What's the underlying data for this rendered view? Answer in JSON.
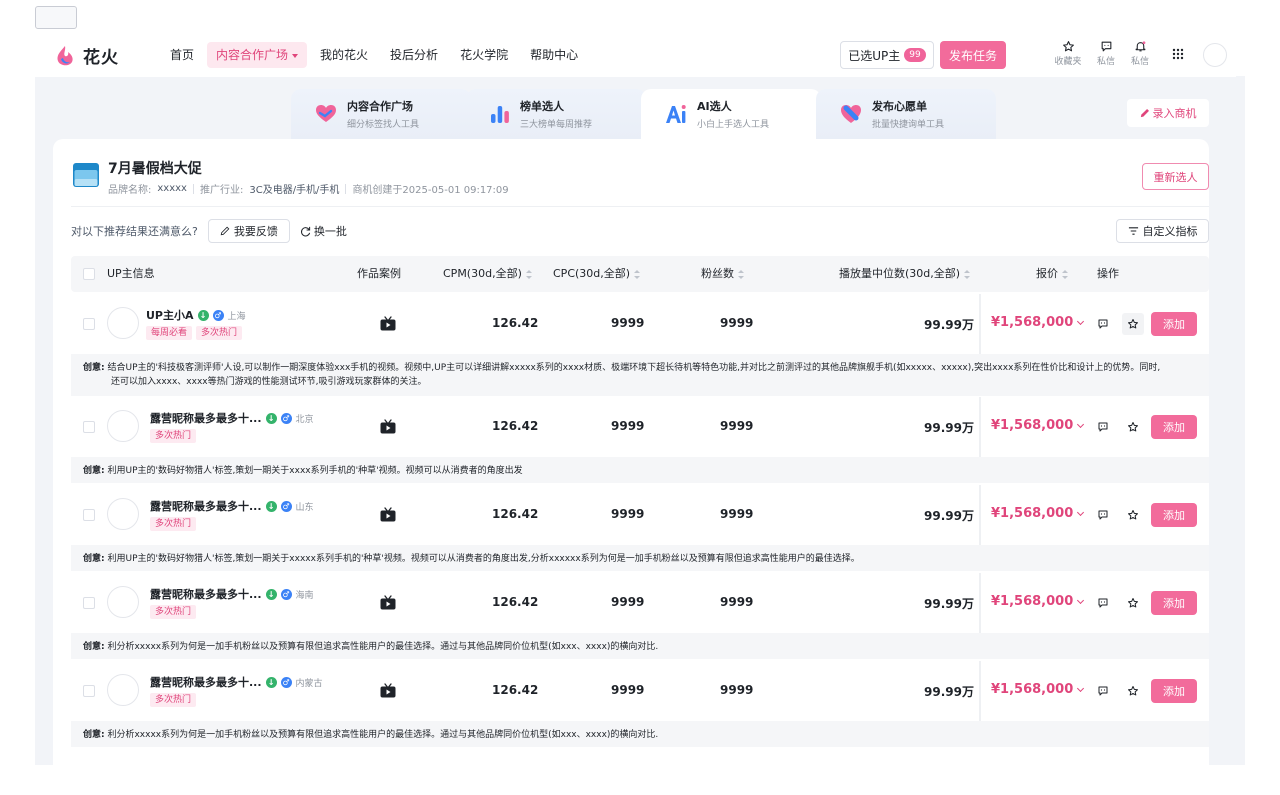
{
  "header": {
    "brand": "花火",
    "nav": [
      {
        "label": "首页",
        "active": false
      },
      {
        "label": "内容合作广场",
        "active": true
      },
      {
        "label": "我的花火",
        "active": false
      },
      {
        "label": "投后分析",
        "active": false
      },
      {
        "label": "花火学院",
        "active": false
      },
      {
        "label": "帮助中心",
        "active": false
      }
    ],
    "selected_label": "已选UP主",
    "selected_count": "99",
    "publish_label": "发布任务",
    "favorites_label": "收藏夹",
    "message_label": "私信",
    "notify_label": "私信"
  },
  "tabs": [
    {
      "title": "内容合作广场",
      "sub": "细分标签找人工具"
    },
    {
      "title": "榜单选人",
      "sub": "三大榜单每周推荐"
    },
    {
      "title": "AI选人",
      "sub": "小白上手选人工具"
    },
    {
      "title": "发布心愿单",
      "sub": "批量快捷询单工具"
    }
  ],
  "lead_label": "录入商机",
  "campaign": {
    "title": "7月暑假档大促",
    "brand_label": "品牌名称:",
    "brand_value": "xxxxx",
    "industry_label": "推广行业:",
    "industry_value": "3C及电器/手机/手机",
    "created": "商机创建于2025-05-01 09:17:09",
    "reselect_label": "重新选人"
  },
  "feedback": {
    "question": "对以下推荐结果还满意么?",
    "feedback_label": "我要反馈",
    "refresh_label": "换一批",
    "metric_label": "自定义指标"
  },
  "table": {
    "columns": {
      "up": "UP主信息",
      "works": "作品案例",
      "cpm": "CPM(30d,全部)",
      "cpc": "CPC(30d,全部)",
      "fans": "粉丝数",
      "plays": "播放量中位数(30d,全部)",
      "price": "报价",
      "ops": "操作"
    },
    "add_label": "添加",
    "idea_label": "创意:",
    "rows": [
      {
        "name": "UP主小A",
        "location": "上海",
        "tags": [
          "每周必看",
          "多次热门"
        ],
        "cpm": "126.42",
        "cpc": "9999",
        "fans": "9999",
        "plays": "99.99万",
        "price": "¥1,568,000",
        "idea_line1": "结合UP主的'科技极客测评师'人设,可以制作一期深度体验xxx手机的视频。视频中,UP主可以详细讲解xxxxx系列的xxxx材质、极端环境下超长待机等特色功能,并对比之前测评过的其他品牌旗舰手机(如xxxxx、xxxxx),突出xxxx系列在性价比和设计上的优势。同时,",
        "idea_line2": "还可以加入xxxx、xxxx等热门游戏的性能测试环节,吸引游戏玩家群体的关注。"
      },
      {
        "name": "露营昵称最多最多十...",
        "location": "北京",
        "tags": [
          "多次热门"
        ],
        "cpm": "126.42",
        "cpc": "9999",
        "fans": "9999",
        "plays": "99.99万",
        "price": "¥1,568,000",
        "idea_line1": "利用UP主的'数码好物猎人'标签,策划一期关于xxxx系列手机的'种草'视频。视频可以从消费者的角度出发",
        "idea_line2": ""
      },
      {
        "name": "露营昵称最多最多十...",
        "location": "山东",
        "tags": [
          "多次热门"
        ],
        "cpm": "126.42",
        "cpc": "9999",
        "fans": "9999",
        "plays": "99.99万",
        "price": "¥1,568,000",
        "idea_line1": "利用UP主的'数码好物猎人'标签,策划一期关于xxxxx系列手机的'种草'视频。视频可以从消费者的角度出发,分析xxxxxx系列为何是一加手机粉丝以及预算有限但追求高性能用户的最佳选择。",
        "idea_line2": ""
      },
      {
        "name": "露营昵称最多最多十...",
        "location": "海南",
        "tags": [
          "多次热门"
        ],
        "cpm": "126.42",
        "cpc": "9999",
        "fans": "9999",
        "plays": "99.99万",
        "price": "¥1,568,000",
        "idea_line1": "利分析xxxxx系列为何是一加手机粉丝以及预算有限但追求高性能用户的最佳选择。通过与其他品牌同价位机型(如xxx、xxxx)的横向对比.",
        "idea_line2": ""
      },
      {
        "name": "露营昵称最多最多十...",
        "location": "内蒙古",
        "tags": [
          "多次热门"
        ],
        "cpm": "126.42",
        "cpc": "9999",
        "fans": "9999",
        "plays": "99.99万",
        "price": "¥1,568,000",
        "idea_line1": "利分析xxxxx系列为何是一加手机粉丝以及预算有限但追求高性能用户的最佳选择。通过与其他品牌同价位机型(如xxx、xxxx)的横向对比.",
        "idea_line2": ""
      }
    ]
  },
  "colors": {
    "accent": "#f26b9b",
    "accent_text": "#e0457b",
    "tag_bg": "#fdeaf1"
  }
}
